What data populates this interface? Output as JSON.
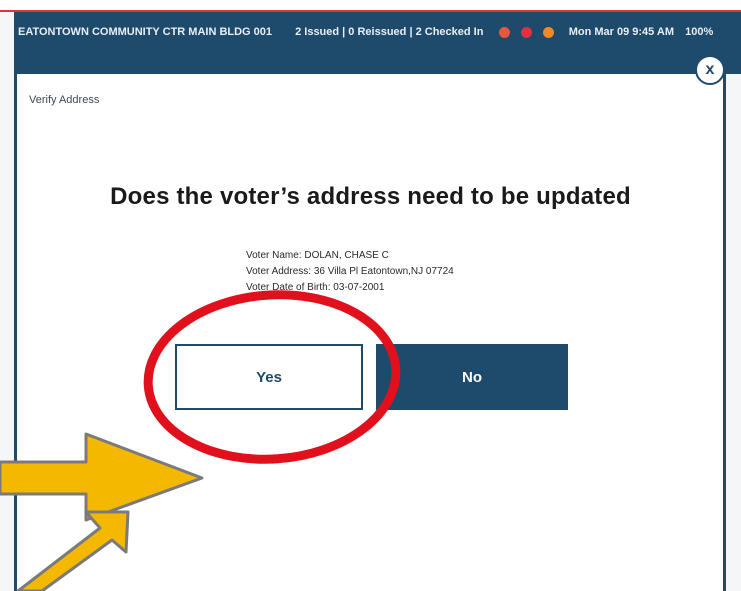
{
  "statusbar": {
    "location": "EATONTOWN COMMUNITY CTR MAIN BLDG 001",
    "counts": "2 Issued | 0 Reissued | 2 Checked In",
    "datetime": "Mon Mar 09 9:45 AM",
    "battery": "100%",
    "icon_colors": [
      "#e8563f",
      "#e0323c",
      "#f08a24"
    ]
  },
  "modal": {
    "title": "Verify Address",
    "close_label": "x",
    "question": "Does the voter’s address need to be updated",
    "voter_name": "Voter Name: DOLAN, CHASE C",
    "voter_address": "Voter Address: 36 Villa Pl Eatontown,NJ 07724",
    "voter_dob": "Voter Date of Birth: 03-07-2001",
    "yes_label": "Yes",
    "no_label": "No"
  },
  "colors": {
    "primary": "#1e4a6b",
    "highlight_circle": "#e0101c",
    "arrow_fill": "#f5b800",
    "arrow_stroke": "#7a7a7a"
  }
}
